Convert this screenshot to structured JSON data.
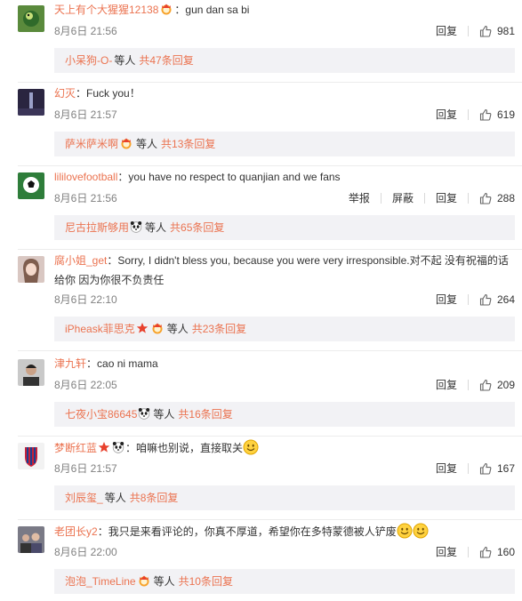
{
  "ui": {
    "reply_label": "回复",
    "report_label": "举报",
    "block_label": "屏蔽",
    "and_others": "等人",
    "colon": "：",
    "colors": {
      "username": "#eb7350",
      "meta": "#808080",
      "reply_bg": "#f2f2f5"
    }
  },
  "comments": [
    {
      "user": "天上有个大猩猩12138",
      "text": "gun dan sa bi",
      "badges": [
        "vip-crown-icon"
      ],
      "time": "8月6日 21:56",
      "likes": "981",
      "reply_user": "小呆狗-O-",
      "reply_badges": [],
      "reply_count": "共47条回复"
    },
    {
      "user": "幻灭",
      "text": "Fuck you！",
      "badges": [],
      "time": "8月6日 21:57",
      "likes": "619",
      "reply_user": "萨米萨米啊",
      "reply_badges": [
        "vip-crown-icon"
      ],
      "reply_count": "共13条回复"
    },
    {
      "user": "lililovefootball",
      "text": "you have no respect to quanjian and we fans",
      "badges": [],
      "time": "8月6日 21:56",
      "likes": "288",
      "show_report": true,
      "reply_user": "尼古拉斯够用",
      "reply_badges": [
        "panda-icon"
      ],
      "reply_count": "共65条回复"
    },
    {
      "user": "腐小姐_get",
      "text": "Sorry, I didn't bless you, because you were very irresponsible.对不起 没有祝福的话",
      "text2": "给你 因为你很不负责任",
      "badges": [],
      "time": "8月6日 22:10",
      "likes": "264",
      "reply_user": "iPheask菲思克",
      "reply_badges": [
        "red-star-icon",
        "vip-crown-icon"
      ],
      "reply_count": "共23条回复"
    },
    {
      "user": "津九轩",
      "text": "cao ni mama",
      "badges": [],
      "time": "8月6日 22:05",
      "likes": "209",
      "reply_user": "七夜小宝86645",
      "reply_badges": [
        "panda-icon"
      ],
      "reply_count": "共16条回复"
    },
    {
      "user": "梦断红蓝",
      "text": "咱嘛也别说，直接取关",
      "badges": [
        "red-star-icon",
        "panda-icon"
      ],
      "emoji": 1,
      "time": "8月6日 21:57",
      "likes": "167",
      "reply_user": "刘辰玺_",
      "reply_badges": [],
      "reply_count": "共8条回复"
    },
    {
      "user": "老团长y2",
      "text": "我只是来看评论的，你真不厚道，希望你在多特蒙德被人铲废",
      "badges": [],
      "emoji": 2,
      "time": "8月6日 22:00",
      "likes": "160",
      "reply_user": "泡泡_TimeLine",
      "reply_badges": [
        "vip-crown-icon"
      ],
      "reply_count": "共10条回复"
    }
  ]
}
